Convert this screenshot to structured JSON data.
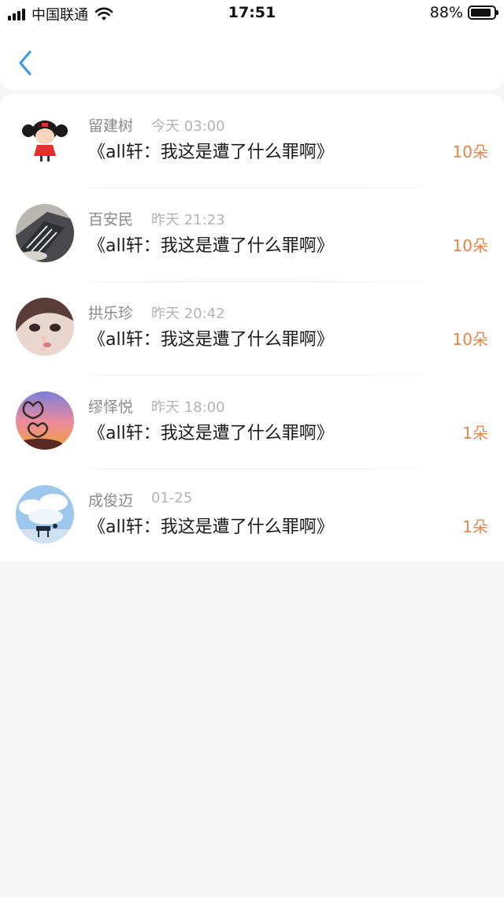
{
  "status": {
    "carrier": "中国联通",
    "time": "17:51",
    "battery_percent": "88%",
    "battery_level": 0.88
  },
  "nav": {
    "back_icon": "chevron-left-icon"
  },
  "colors": {
    "accent": "#3a9be6",
    "count": "#e5854b"
  },
  "items": [
    {
      "name": "留建树",
      "time": "今天 03:00",
      "title": "《all轩：我这是遭了什么罪啊》",
      "count": "10朵"
    },
    {
      "name": "百安民",
      "time": "昨天 21:23",
      "title": "《all轩：我这是遭了什么罪啊》",
      "count": "10朵"
    },
    {
      "name": "拱乐珍",
      "time": "昨天 20:42",
      "title": "《all轩：我这是遭了什么罪啊》",
      "count": "10朵"
    },
    {
      "name": "缪怿悦",
      "time": "昨天 18:00",
      "title": "《all轩：我这是遭了什么罪啊》",
      "count": "1朵"
    },
    {
      "name": "成俊迈",
      "time": "01-25",
      "title": "《all轩：我这是遭了什么罪啊》",
      "count": "1朵"
    }
  ]
}
